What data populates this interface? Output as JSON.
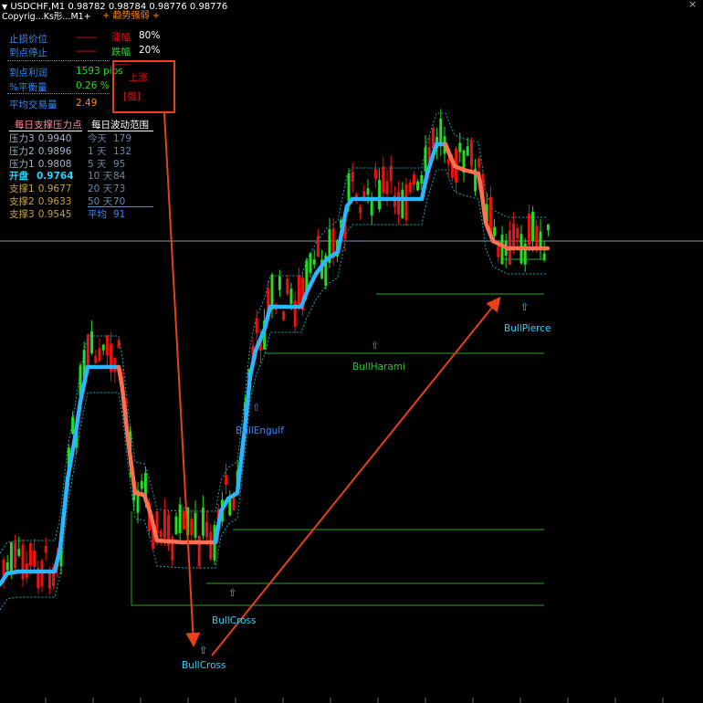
{
  "window": {
    "symbol_line": "USDCHF,M1  0.98782 0.98784 0.98776 0.98776",
    "sub_line": "Copyrig...Ks形...M1+",
    "strength_label": "+ 趋势强弱 +"
  },
  "panel": {
    "stop_loss_label": "止损价位",
    "take_stop_label": "到点停止",
    "dash_text": "--------",
    "rise_label": "涨幅",
    "rise_value": "80%",
    "fall_label": "跌幅",
    "fall_value": "20%",
    "profit_label": "到点利润",
    "profit_value": "1593 pips",
    "balance_label": "%平衡量",
    "balance_value": "0.26 %",
    "avg_label": "平均交易量",
    "avg_value": "2.49",
    "trend_box_up": "上涨",
    "trend_box_strong": "[强]"
  },
  "pivots": {
    "header": "每日支撑压力点",
    "rows": [
      {
        "label": "压力3",
        "value": "0.9940",
        "color": "#a0b4c8"
      },
      {
        "label": "压力2",
        "value": "0.9896",
        "color": "#a0b4c8"
      },
      {
        "label": "压力1",
        "value": "0.9808",
        "color": "#a0b4c8"
      },
      {
        "label": "开盘",
        "value": "0.9764",
        "color": "#2ed2ff"
      },
      {
        "label": "支撑1",
        "value": "0.9677",
        "color": "#c8a040"
      },
      {
        "label": "支撑2",
        "value": "0.9633",
        "color": "#c8a040"
      },
      {
        "label": "支撑3",
        "value": "0.9545",
        "color": "#c8a040"
      }
    ]
  },
  "ranges": {
    "header": "每日波动范围",
    "rows": [
      {
        "label": "今天",
        "value": "179"
      },
      {
        "label": "1 天",
        "value": "132"
      },
      {
        "label": "5 天",
        "value": "95"
      },
      {
        "label": "10 天",
        "value": "84"
      },
      {
        "label": "20 天",
        "value": "73"
      },
      {
        "label": "50 天",
        "value": "70"
      },
      {
        "label": "平均",
        "value": "91"
      }
    ]
  },
  "patterns": [
    {
      "label": "BullCross",
      "color": "#2ed2ff"
    },
    {
      "label": "BullCross",
      "color": "#2ed2ff"
    },
    {
      "label": "BullEngulf",
      "color": "#2e8bff"
    },
    {
      "label": "BullHarami",
      "color": "#22cc22"
    },
    {
      "label": "BullPierce",
      "color": "#2ed2ff"
    }
  ],
  "colors": {
    "bull_candle": "#22dd22",
    "bear_candle": "#ee1111",
    "trend_up": "#2bb6ff",
    "trend_down": "#ff7050",
    "annotation": "#e8401a",
    "support_line": "#22aa22",
    "price_line": "#8a9aa8"
  },
  "chart_data": {
    "type": "candlestick",
    "symbol": "USDCHF",
    "timeframe": "M1",
    "last_price": 0.98776,
    "ohlc_header": {
      "open": 0.98782,
      "high": 0.98784,
      "low": 0.98776,
      "close": 0.98776
    },
    "notes": "Candlestick price series with blue/orange trend line (blue = up, orange = down) and cyan dotted envelope bands; horizontal green support lines drawn from BullCross, BullCross, BullEngulf, BullHarami, BullPierce signals; two orange arrows linking the trend box to the lower BullCross and from BullCross up to BullPierce."
  }
}
